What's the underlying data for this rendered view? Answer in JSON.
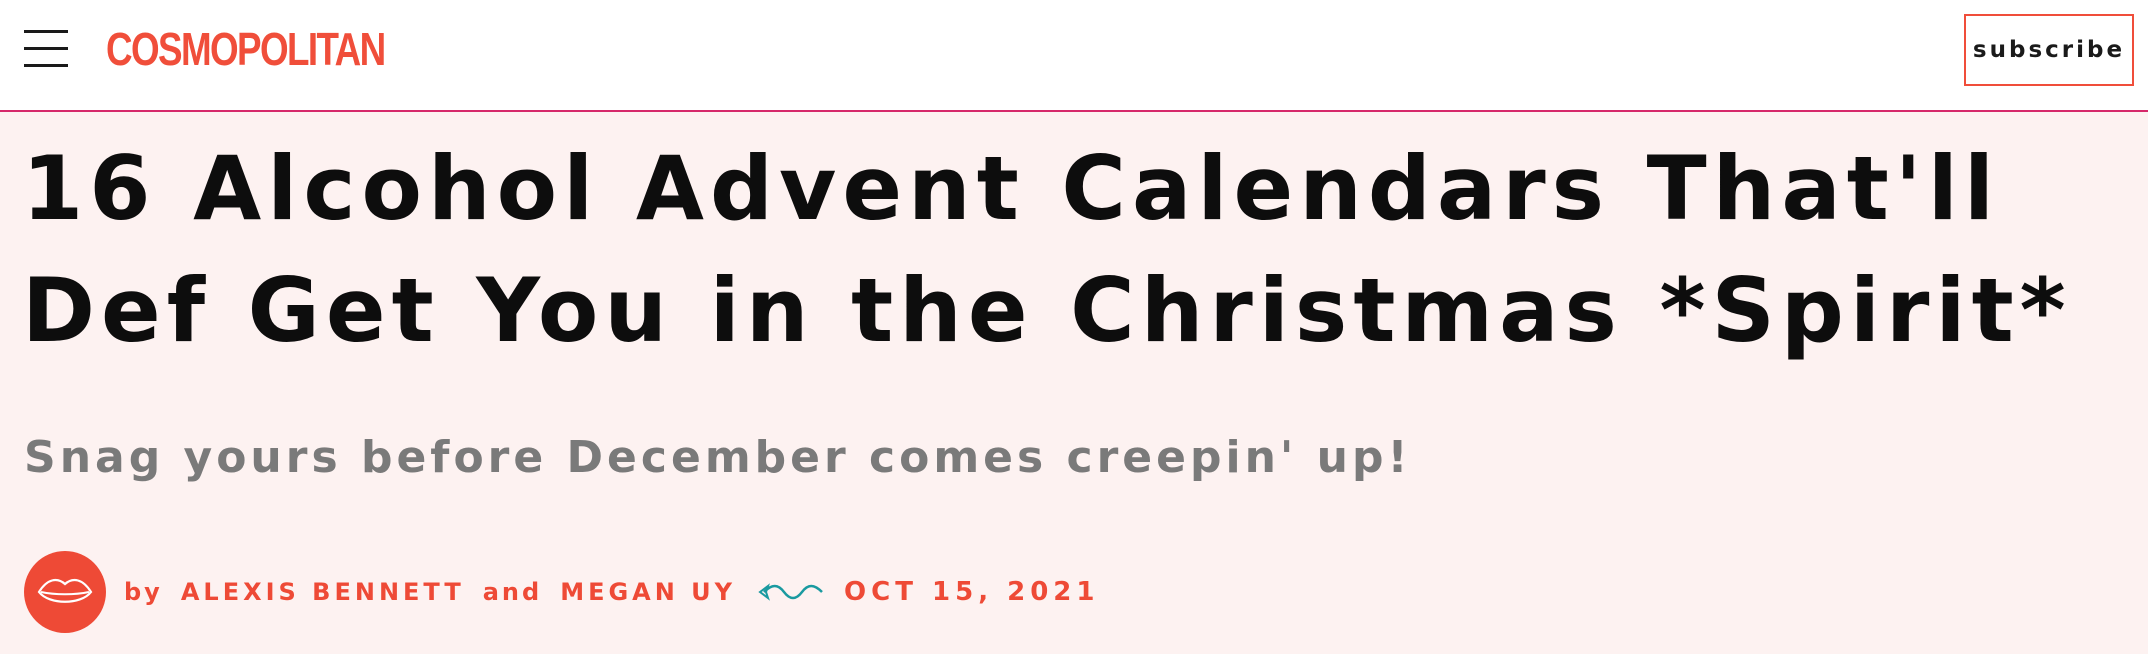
{
  "header": {
    "menu_icon": "hamburger-menu-icon",
    "logo": "COSMOPOLITAN",
    "subscribe_label": "subscribe",
    "accent_color": "#f04e3a",
    "divider_color": "#d6286a"
  },
  "article": {
    "headline": "16 Alcohol Advent Calendars That'll Def Get You in the Christmas *Spirit*",
    "dek": "Snag yours before December comes creepin' up!",
    "byline": {
      "avatar_icon": "lips-icon",
      "by": "by",
      "authors": [
        "ALEXIS BENNETT",
        "MEGAN UY"
      ],
      "and": "and",
      "separator_icon": "squiggle-icon",
      "date": "OCT 15, 2021"
    }
  },
  "colors": {
    "page_background": "#fdf2f1",
    "headline": "#0d0d0d",
    "dek": "#7a7a7a",
    "byline": "#ee4a36"
  }
}
